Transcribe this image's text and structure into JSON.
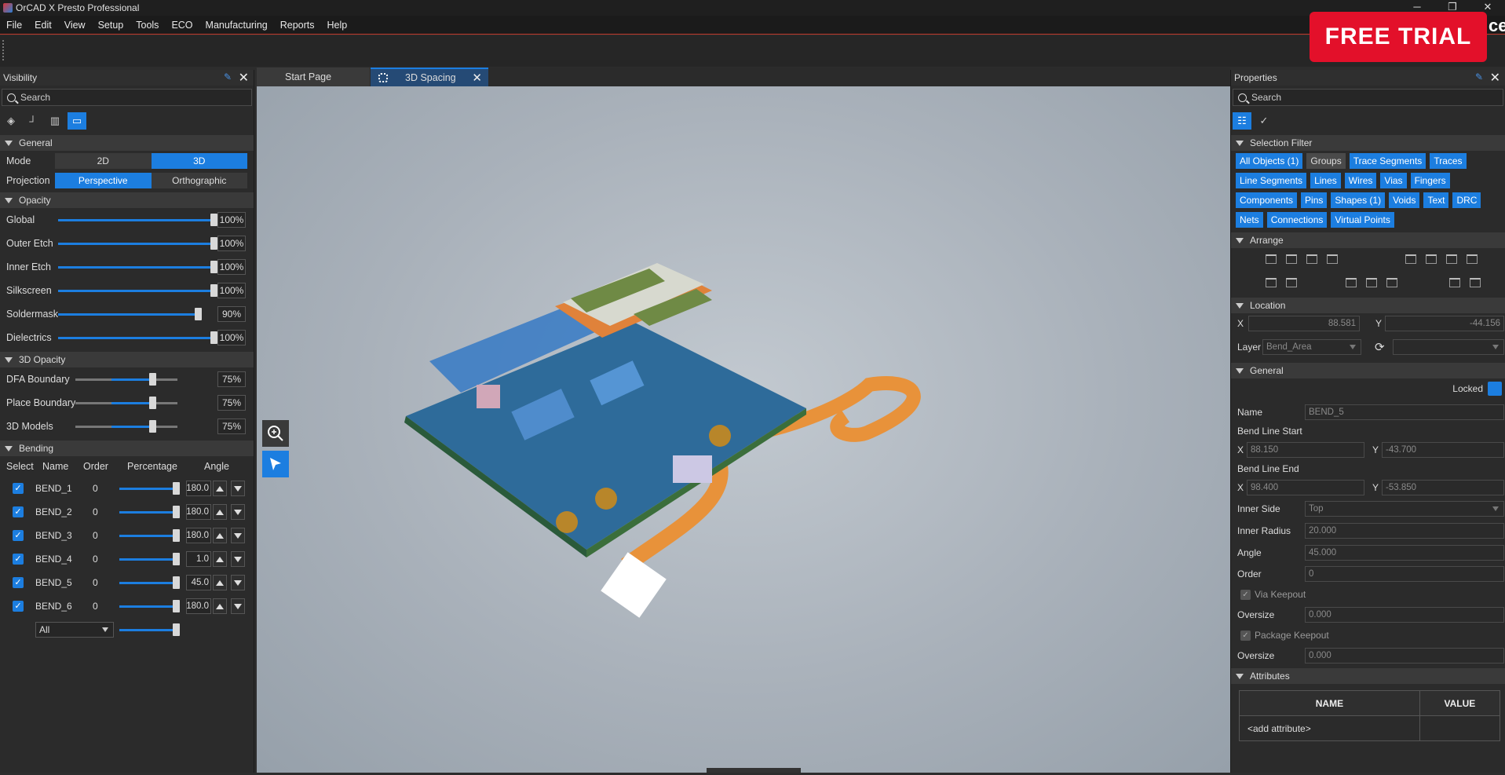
{
  "window": {
    "title": "OrCAD X Presto Professional",
    "minimize": "─",
    "restore": "❐",
    "close": "✕"
  },
  "menu": [
    "File",
    "Edit",
    "View",
    "Setup",
    "Tools",
    "ECO",
    "Manufacturing",
    "Reports",
    "Help"
  ],
  "banner": {
    "label": "FREE TRIAL",
    "trailing": "ce"
  },
  "tabs": {
    "start": "Start Page",
    "active": "3D Spacing"
  },
  "visibility": {
    "title": "Visibility",
    "search_placeholder": "Search",
    "general": {
      "title": "General",
      "mode_label": "Mode",
      "mode_options": [
        "2D",
        "3D"
      ],
      "mode_selected": "3D",
      "projection_label": "Projection",
      "projection_options": [
        "Perspective",
        "Orthographic"
      ],
      "projection_selected": "Perspective"
    },
    "opacity": {
      "title": "Opacity",
      "items": [
        {
          "label": "Global",
          "value": "100%",
          "level": 1.0
        },
        {
          "label": "Outer Etch",
          "value": "100%",
          "level": 1.0
        },
        {
          "label": "Inner Etch",
          "value": "100%",
          "level": 1.0
        },
        {
          "label": "Silkscreen",
          "value": "100%",
          "level": 1.0
        },
        {
          "label": "Soldermask",
          "value": "90%",
          "level": 0.9
        },
        {
          "label": "Dielectrics",
          "value": "100%",
          "level": 1.0
        }
      ]
    },
    "opacity3d": {
      "title": "3D Opacity",
      "items": [
        {
          "label": "DFA Boundary",
          "value": "75%",
          "level": 0.75
        },
        {
          "label": "Place Boundary",
          "value": "75%",
          "level": 0.75
        },
        {
          "label": "3D Models",
          "value": "75%",
          "level": 0.75
        }
      ]
    },
    "bending": {
      "title": "Bending",
      "headers": [
        "Select",
        "Name",
        "Order",
        "Percentage",
        "Angle"
      ],
      "rows": [
        {
          "name": "BEND_1",
          "order": "0",
          "angle": "180.0"
        },
        {
          "name": "BEND_2",
          "order": "0",
          "angle": "180.0"
        },
        {
          "name": "BEND_3",
          "order": "0",
          "angle": "180.0"
        },
        {
          "name": "BEND_4",
          "order": "0",
          "angle": "1.0"
        },
        {
          "name": "BEND_5",
          "order": "0",
          "angle": "45.0"
        },
        {
          "name": "BEND_6",
          "order": "0",
          "angle": "180.0"
        }
      ],
      "all_option": "All"
    }
  },
  "properties": {
    "title": "Properties",
    "search_placeholder": "Search",
    "selection_filter": {
      "title": "Selection Filter",
      "chips": [
        {
          "label": "All Objects (1)",
          "on": true
        },
        {
          "label": "Groups",
          "on": false
        },
        {
          "label": "Trace Segments",
          "on": true
        },
        {
          "label": "Traces",
          "on": true
        },
        {
          "label": "Line Segments",
          "on": true
        },
        {
          "label": "Lines",
          "on": true
        },
        {
          "label": "Wires",
          "on": true
        },
        {
          "label": "Vias",
          "on": true
        },
        {
          "label": "Fingers",
          "on": true
        },
        {
          "label": "Components",
          "on": true
        },
        {
          "label": "Pins",
          "on": true
        },
        {
          "label": "Shapes (1)",
          "on": true
        },
        {
          "label": "Voids",
          "on": true
        },
        {
          "label": "Text",
          "on": true
        },
        {
          "label": "DRC",
          "on": true
        },
        {
          "label": "Nets",
          "on": true
        },
        {
          "label": "Connections",
          "on": true
        },
        {
          "label": "Virtual Points",
          "on": true
        }
      ]
    },
    "arrange": {
      "title": "Arrange"
    },
    "location": {
      "title": "Location",
      "x_label": "X",
      "x": "88.581",
      "y_label": "Y",
      "y": "-44.156",
      "layer_label": "Layer",
      "layer": "Bend_Area"
    },
    "general": {
      "title": "General",
      "locked_label": "Locked",
      "name_label": "Name",
      "name": "BEND_5",
      "start_label": "Bend Line Start",
      "start_x": "88.150",
      "start_y": "-43.700",
      "end_label": "Bend Line End",
      "end_x": "98.400",
      "end_y": "-53.850",
      "inner_side_label": "Inner Side",
      "inner_side": "Top",
      "inner_radius_label": "Inner Radius",
      "inner_radius": "20.000",
      "angle_label": "Angle",
      "angle": "45.000",
      "order_label": "Order",
      "order": "0",
      "via_keepout_label": "Via Keepout",
      "oversize_label": "Oversize",
      "oversize1": "0.000",
      "package_keepout_label": "Package Keepout",
      "oversize2": "0.000",
      "x_label": "X",
      "y_label": "Y"
    },
    "attributes": {
      "title": "Attributes",
      "name_header": "NAME",
      "value_header": "VALUE",
      "add_row": "<add attribute>"
    }
  }
}
